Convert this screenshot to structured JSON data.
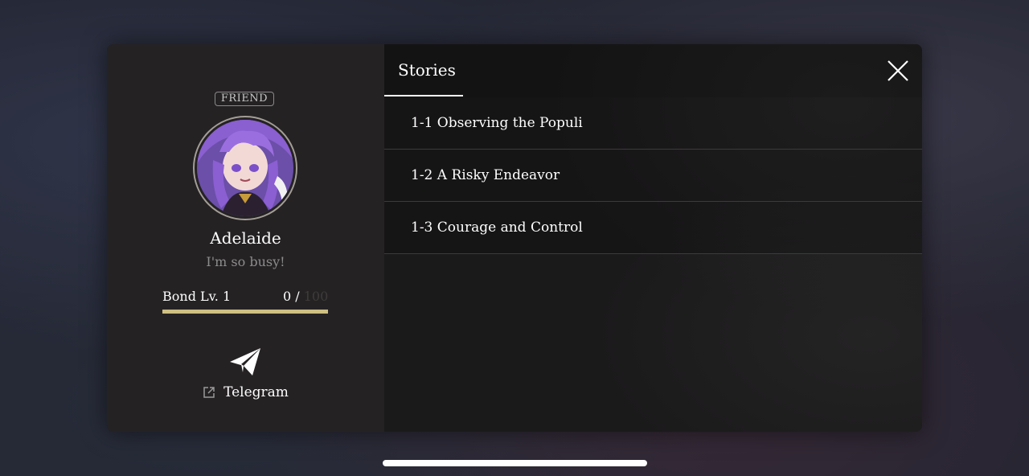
{
  "profile": {
    "badge": "FRIEND",
    "name": "Adelaide",
    "status": "I'm so busy!",
    "bond_label": "Bond Lv. 1",
    "bond_current": "0 /",
    "bond_max": "100",
    "bond_fill_fraction": 1,
    "bond_color": "#cfc083",
    "send_icon": "paper-plane-icon",
    "link_icon": "external-link-icon",
    "link_label": "Telegram"
  },
  "stories": {
    "tab_label": "Stories",
    "close_icon": "close-icon",
    "items": [
      {
        "label": "1-1 Observing the Populi"
      },
      {
        "label": "1-2 A Risky Endeavor"
      },
      {
        "label": "1-3 Courage and Control"
      }
    ]
  }
}
